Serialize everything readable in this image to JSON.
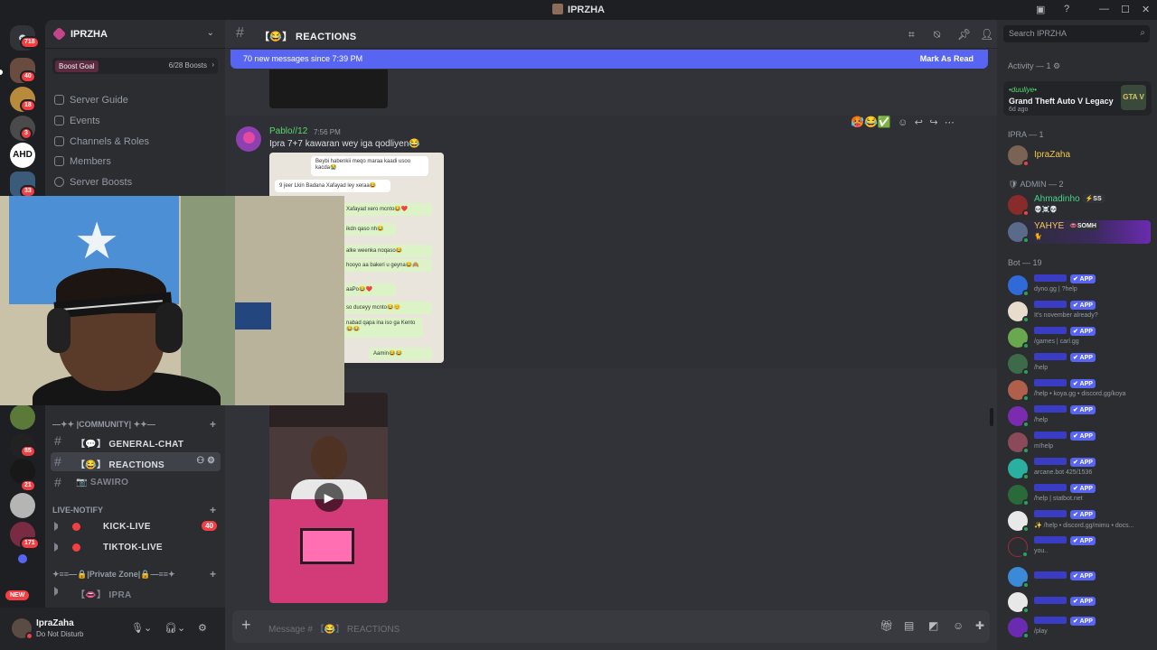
{
  "window": {
    "title": "IPRZHA"
  },
  "rail": {
    "badges": [
      "718",
      "40",
      "18",
      "3",
      "33",
      "85",
      "21",
      "171"
    ],
    "ahd_label": "AHD",
    "new_label": "NEW"
  },
  "sidebar": {
    "guild_name": "IPRZHA",
    "boost": {
      "label": "Boost Goal",
      "progress": "6/28 Boosts"
    },
    "nav": [
      "Server Guide",
      "Events",
      "Channels & Roles",
      "Members",
      "Server Boosts"
    ],
    "categories": {
      "community": "—✦✦ |COMMUNITY| ✦✦—",
      "live": "LIVE-NOTIFY",
      "private": "✦≡≡—🔒|Private Zone|🔒—≡≡✦"
    },
    "channels": [
      {
        "name": "【💬】 GENERAL-CHAT"
      },
      {
        "name": "【😂】 REACTIONS"
      },
      {
        "name": "📷 SAWIRO"
      },
      {
        "name": "KICK-LIVE",
        "badge": "40"
      },
      {
        "name": "TIKTOK-LIVE"
      },
      {
        "name": "【👄】 IPRA"
      }
    ]
  },
  "user": {
    "name": "IpraZaha",
    "status": "Do Not Disturb"
  },
  "chat": {
    "channel_title": "【😂】 REACTIONS",
    "new_messages": "70 new messages since 7:39 PM",
    "mark_read": "Mark As Read",
    "message": {
      "author": "Pablo//12",
      "time": "7:56 PM",
      "text": "Ipra 7+7 kawaran wey iga qodliyen😂",
      "reactions": "🥵😂✅"
    },
    "screenshot_bubbles": [
      "Beybi habenkii meqo maraa kaadi usoo kacda😭",
      "9 jeer Lkin  Badana Xafayad ley xeraa😂",
      "Xafayad xero mcnto😂❤️",
      "ikdn qaso  nh😂",
      "alke weenka noqaso😂",
      "hooyo aa bakeri u geyna😂🙈",
      "aaPo😂❤️",
      "so duceyy mcnto😂😊",
      "nabad qapa ina iso ga Kento😂😂",
      "Aamin😂😂"
    ],
    "composer_placeholder": "Message # 【😂】 REACTIONS"
  },
  "members": {
    "search_placeholder": "Search IPRZHA",
    "activity_header": "Activity — 1",
    "activity": {
      "user": "•duuliye•",
      "game": "Grand Theft Auto V Legacy",
      "time": "6d ago",
      "logo": "GTA V"
    },
    "sections": {
      "ipra": "IPRA — 1",
      "admin": "ADMIN — 2",
      "bot": "Bot — 19"
    },
    "ipra_members": [
      {
        "name": "IpraZaha"
      }
    ],
    "admins": [
      {
        "name": "Ahmadinho",
        "tag": "⚡SS",
        "status": "💀☠️💀"
      },
      {
        "name": "YAHYE",
        "tag": "👄SOMH",
        "status": "🐈"
      }
    ],
    "bots": [
      {
        "status": "dyno.gg | ?help"
      },
      {
        "status": "It's november already?"
      },
      {
        "status": "/games | carl.gg"
      },
      {
        "status": "/help"
      },
      {
        "status": "/help • koya.gg • discord.gg/koya"
      },
      {
        "status": "/help"
      },
      {
        "status": "m!help"
      },
      {
        "status": "arcane.bot 425/1536"
      },
      {
        "status": "/help | statbot.net"
      },
      {
        "status": "✨ /help • discord.gg/mimu • docs..."
      },
      {
        "status": "you.."
      },
      {
        "status": ""
      },
      {
        "status": ""
      },
      {
        "status": "/play"
      }
    ],
    "app_label": "✔ APP"
  },
  "colors": {
    "accent": "#5865f2",
    "danger": "#f23f43",
    "online": "#23a55a",
    "author": "#57d86b"
  }
}
